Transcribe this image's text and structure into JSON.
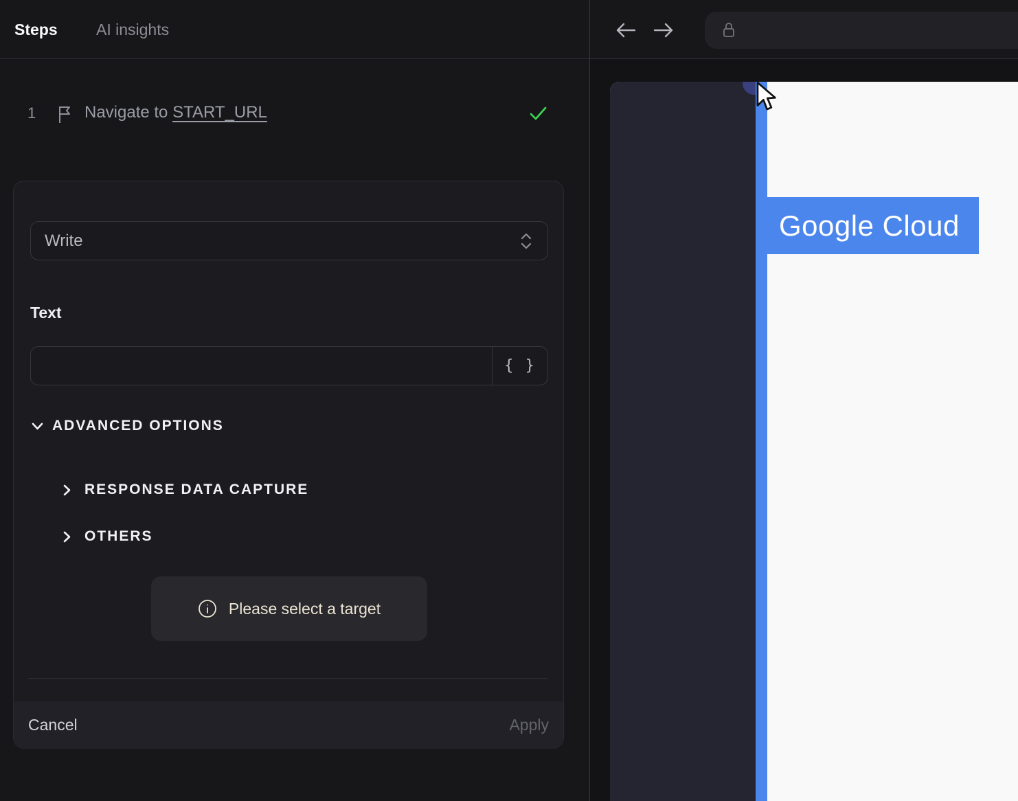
{
  "left_panel": {
    "tabs": [
      {
        "label": "Steps",
        "active": true
      },
      {
        "label": "AI insights",
        "active": false
      }
    ],
    "step": {
      "index": "1",
      "label_prefix": "Navigate to ",
      "label_link": "START_URL",
      "status": "success"
    },
    "editor_card": {
      "action_select": {
        "value": "Write"
      },
      "text_field": {
        "label": "Text",
        "value": "",
        "variable_button_label": "{ }"
      },
      "advanced_options": {
        "label": "ADVANCED OPTIONS",
        "expanded": true
      },
      "sections": [
        {
          "label": "RESPONSE DATA CAPTURE",
          "expanded": false
        },
        {
          "label": "OTHERS",
          "expanded": false
        }
      ],
      "notice": {
        "text": "Please select a target"
      },
      "footer": {
        "cancel_label": "Cancel",
        "apply_label": "Apply",
        "apply_enabled": false
      }
    }
  },
  "browser_panel": {
    "address_bar": {
      "value": ""
    },
    "page": {
      "banner_text": "Google Cloud"
    }
  },
  "icons": [
    "flag-icon",
    "check-icon",
    "unfold-icon",
    "braces-icon",
    "chevron-down-icon",
    "chevron-right-icon",
    "info-icon",
    "arrow-left-icon",
    "arrow-right-icon",
    "lock-icon",
    "cursor-icon"
  ],
  "colors": {
    "accent_blue": "#4b86ec",
    "success_green": "#3ddc55",
    "notice_text": "#ece4d3",
    "indigo_dot": "#3a3f7d",
    "sidebar_navy": "#242531",
    "page_white": "#f9f9f9",
    "panel_dark": "#17171a"
  }
}
